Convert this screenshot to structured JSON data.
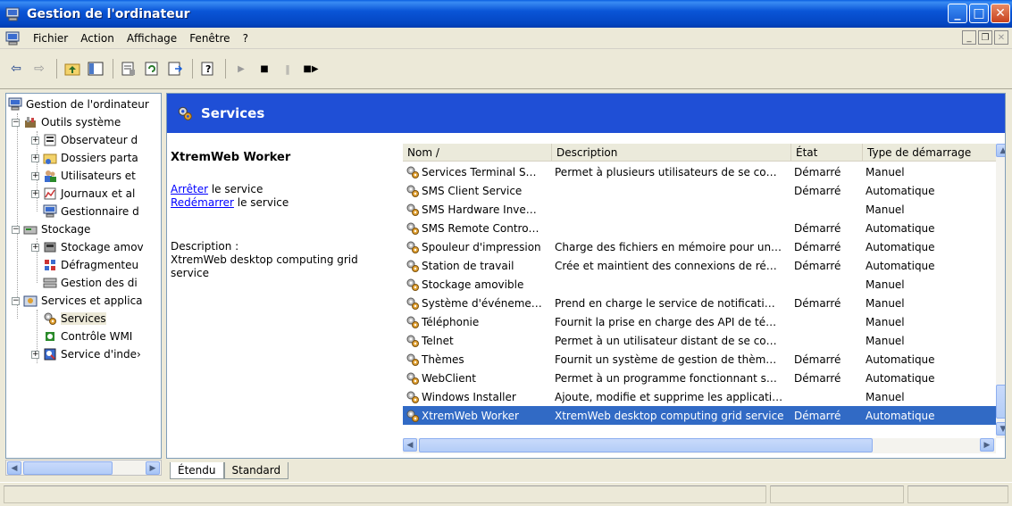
{
  "window": {
    "title": "Gestion de l'ordinateur"
  },
  "menu": {
    "items": [
      "Fichier",
      "Action",
      "Affichage",
      "Fenêtre",
      "?"
    ]
  },
  "tree": {
    "root": "Gestion de l'ordinateur",
    "outils": "Outils système",
    "observateur": "Observateur d",
    "dossiers": "Dossiers parta",
    "utilisateurs": "Utilisateurs et",
    "journaux": "Journaux et al",
    "gestionnaire": "Gestionnaire d",
    "stockage": "Stockage",
    "stockage_amov": "Stockage amov",
    "defrag": "Défragmenteu",
    "gestion_dis": "Gestion des di",
    "services_app": "Services et applica",
    "services": "Services",
    "wmi": "Contrôle WMI",
    "index": "Service d'inde›"
  },
  "header": {
    "title": "Services"
  },
  "details": {
    "name": "XtremWeb Worker",
    "stop_link": "Arrêter",
    "stop_suffix": " le service",
    "restart_link": "Redémarrer",
    "restart_suffix": " le service",
    "desc_label": "Description :",
    "desc_text": "XtremWeb desktop computing grid service"
  },
  "table": {
    "columns": [
      "Nom  /",
      "Description",
      "État",
      "Type de démarrage"
    ],
    "rows": [
      [
        "Services Terminal S…",
        "Permet à plusieurs utilisateurs de se co…",
        "Démarré",
        "Manuel"
      ],
      [
        "SMS Client Service",
        "",
        "Démarré",
        "Automatique"
      ],
      [
        "SMS Hardware Inve…",
        "",
        "",
        "Manuel"
      ],
      [
        "SMS Remote Contro…",
        "",
        "Démarré",
        "Automatique"
      ],
      [
        "Spouleur d'impression",
        "Charge des fichiers en mémoire pour un…",
        "Démarré",
        "Automatique"
      ],
      [
        "Station de travail",
        "Crée et maintient des connexions de ré…",
        "Démarré",
        "Automatique"
      ],
      [
        "Stockage amovible",
        "",
        "",
        "Manuel"
      ],
      [
        "Système d'événeme…",
        "Prend en charge le service de notificati…",
        "Démarré",
        "Manuel"
      ],
      [
        "Téléphonie",
        "Fournit la prise en charge des API de té…",
        "",
        "Manuel"
      ],
      [
        "Telnet",
        "Permet à un utilisateur distant de se co…",
        "",
        "Manuel"
      ],
      [
        "Thèmes",
        "Fournit un système de gestion de thèm…",
        "Démarré",
        "Automatique"
      ],
      [
        "WebClient",
        "Permet à un programme fonctionnant s…",
        "Démarré",
        "Automatique"
      ],
      [
        "Windows Installer",
        "Ajoute, modifie et supprime les applicati…",
        "",
        "Manuel"
      ],
      [
        "XtremWeb Worker",
        "XtremWeb desktop computing grid service",
        "Démarré",
        "Automatique"
      ]
    ]
  },
  "tabs": {
    "extended": "Étendu",
    "standard": "Standard"
  },
  "colors": {
    "title_blue": "#0a55d7",
    "header_blue": "#1f4fd6",
    "selection": "#316ac5",
    "link": "#0000ff"
  }
}
